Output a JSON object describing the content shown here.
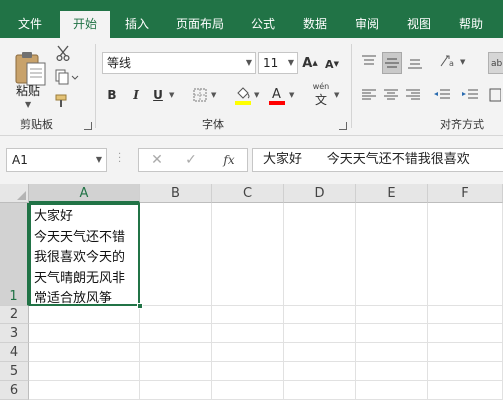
{
  "menu": {
    "tabs": [
      "文件",
      "开始",
      "插入",
      "页面布局",
      "公式",
      "数据",
      "审阅",
      "视图",
      "帮助"
    ],
    "active_tab": "开始"
  },
  "ribbon": {
    "clipboard": {
      "paste_label": "粘贴",
      "group_label": "剪贴板"
    },
    "font": {
      "font_name": "等线",
      "font_size": "11",
      "bold_label": "B",
      "italic_label": "I",
      "underline_label": "U",
      "phonetic_label": "wén",
      "group_label": "字体",
      "highlight_color": "#ffff00",
      "font_color": "#ff0000"
    },
    "alignment": {
      "group_label": "对齐方式"
    }
  },
  "formula_bar": {
    "name_box": "A1",
    "fx_label": "fx",
    "content": "大家好      今天天气还不错我很喜欢"
  },
  "sheet": {
    "columns": [
      "A",
      "B",
      "C",
      "D",
      "E",
      "F"
    ],
    "rows": [
      "1",
      "2",
      "3",
      "4",
      "5",
      "6"
    ],
    "selected_column": "A",
    "selected_row": "1",
    "a1_text": "大家好\n今天天气还不错\n我很喜欢今天的\n天气晴朗无风非\n常适合放风筝"
  },
  "colors": {
    "accent": "#217346"
  }
}
